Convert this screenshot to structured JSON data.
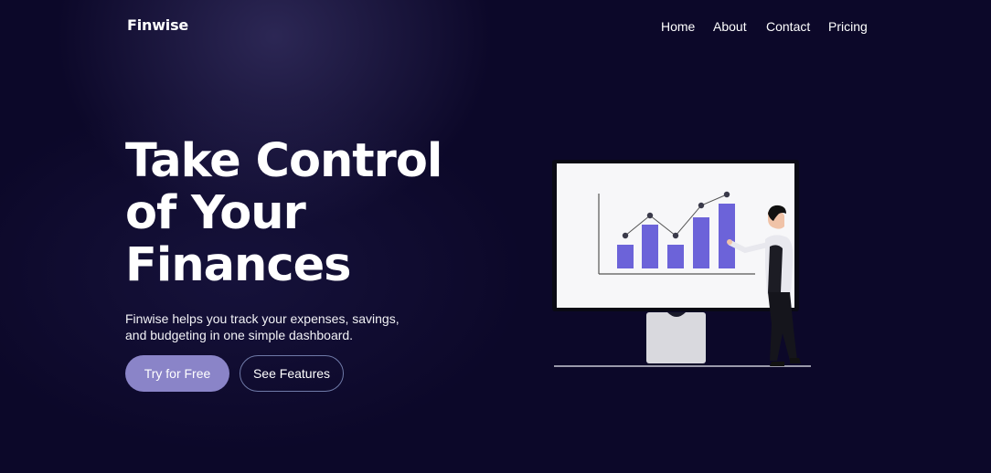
{
  "brand": {
    "name": "Finwise"
  },
  "nav": {
    "items": [
      {
        "label": "Home"
      },
      {
        "label": "About"
      },
      {
        "label": "Contact"
      },
      {
        "label": "Pricing"
      }
    ]
  },
  "hero": {
    "title_lines": [
      "Take Control",
      "of Your",
      "Finances"
    ],
    "subtitle": "Finwise helps you track your expenses, savings, and budgeting in one simple dashboard.",
    "cta_primary": "Try for Free",
    "cta_secondary": "See Features"
  },
  "colors": {
    "background": "#0c0829",
    "primary_button": "#8a84c8",
    "secondary_border": "#6f7aa8",
    "bar_accent": "#6c63d9"
  },
  "illustration": {
    "icon": "presentation-chart-illustration"
  }
}
